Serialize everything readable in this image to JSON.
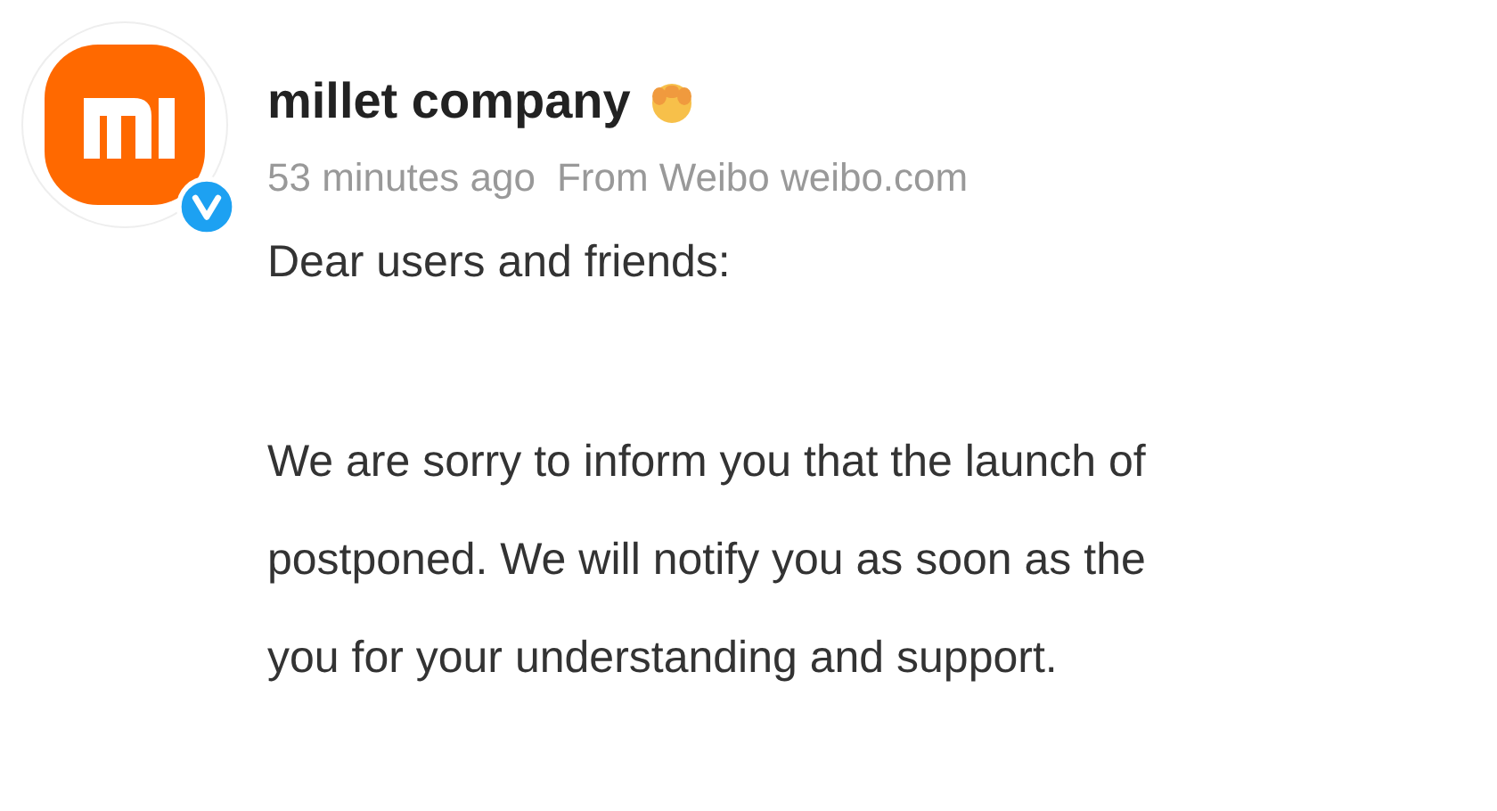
{
  "post": {
    "author": "millet company",
    "verified": true,
    "time": "53 minutes ago",
    "source": "From Weibo weibo.com",
    "paragraphs": [
      [
        "Dear users and friends:"
      ],
      [
        "We are sorry to inform you that the launch of",
        "postponed. We will notify you as soon as the",
        "you for your understanding and support."
      ]
    ]
  }
}
